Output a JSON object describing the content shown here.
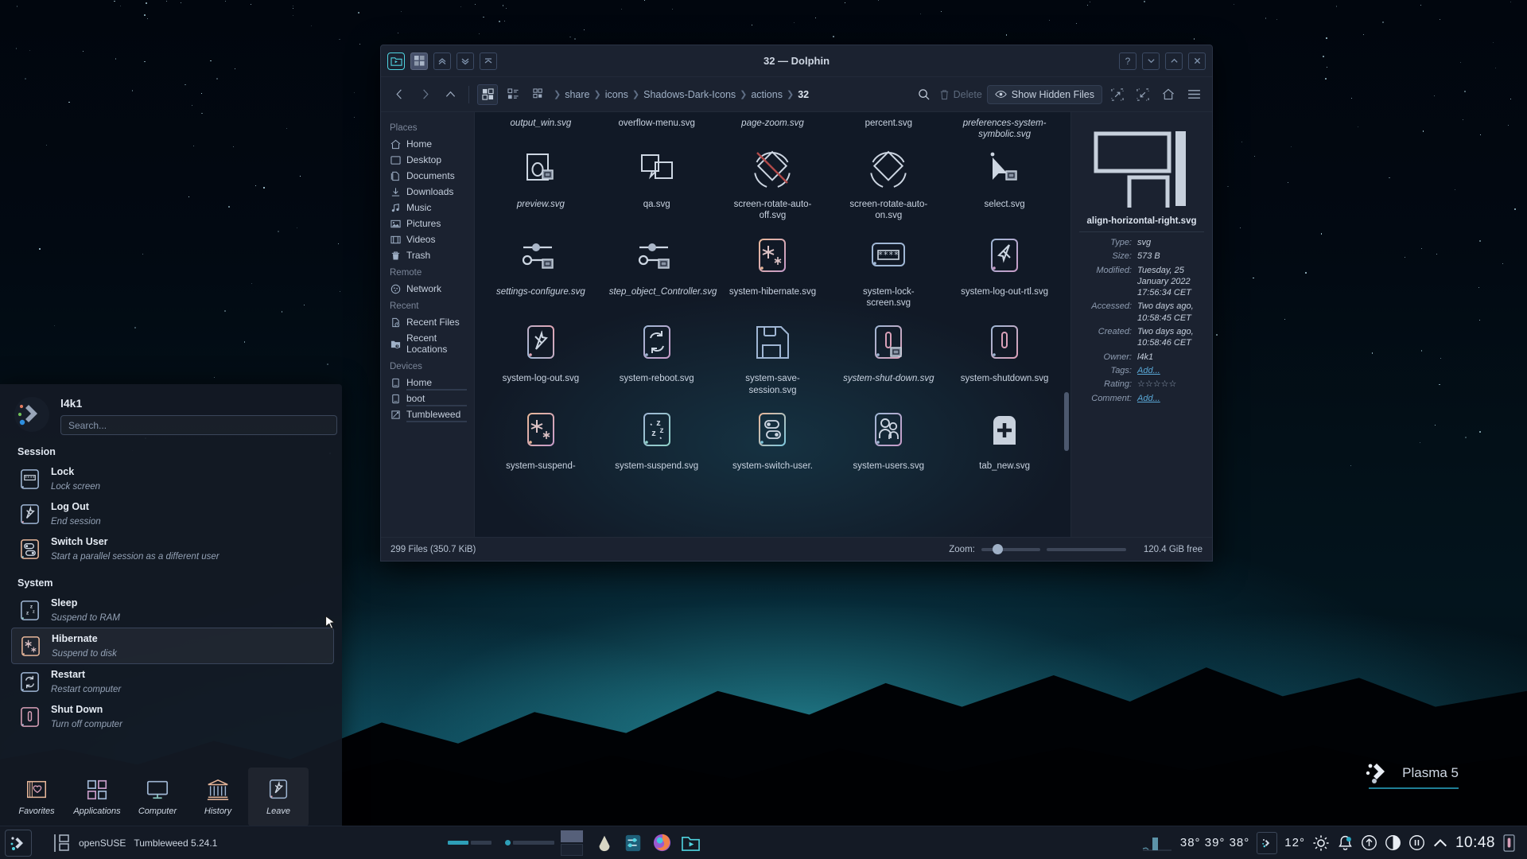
{
  "desktop": {
    "watermark": "Plasma 5"
  },
  "dolphin": {
    "window_title": "32 — Dolphin",
    "titlebar_icons": [
      "folder-icon",
      "tile-grid-icon",
      "chevron-up-double-icon",
      "chevron-down-double-icon",
      "collapse-up-icon"
    ],
    "window_buttons": [
      {
        "name": "help-button",
        "glyph": "?"
      },
      {
        "name": "minimize-button",
        "glyph": "⌄"
      },
      {
        "name": "maximize-button",
        "glyph": "⌃"
      },
      {
        "name": "close-button",
        "glyph": "✕"
      }
    ],
    "toolbar": {
      "back_icon": "back-arrow-icon",
      "forward_icon": "forward-arrow-icon",
      "up_icon": "up-arrow-icon",
      "view_icons": [
        "icons-view-icon",
        "compact-view-icon",
        "details-view-icon"
      ],
      "search_icon": "search-icon",
      "delete_label": "Delete",
      "show_hidden_label": "Show Hidden Files",
      "split_icon": "split-view-icon",
      "collapse_icon": "collapse-view-icon",
      "home_icon": "home-icon",
      "menu_icon": "hamburger-menu-icon"
    },
    "breadcrumb": [
      "share",
      "icons",
      "Shadows-Dark-Icons",
      "actions",
      "32"
    ],
    "breadcrumb_current": "32",
    "places": {
      "sections": [
        {
          "title": "Places",
          "items": [
            {
              "label": "Home",
              "icon": "home-icon"
            },
            {
              "label": "Desktop",
              "icon": "desktop-icon"
            },
            {
              "label": "Documents",
              "icon": "documents-icon"
            },
            {
              "label": "Downloads",
              "icon": "download-icon"
            },
            {
              "label": "Music",
              "icon": "music-icon"
            },
            {
              "label": "Pictures",
              "icon": "pictures-icon"
            },
            {
              "label": "Videos",
              "icon": "video-icon"
            },
            {
              "label": "Trash",
              "icon": "trash-icon"
            }
          ]
        },
        {
          "title": "Remote",
          "items": [
            {
              "label": "Network",
              "icon": "network-icon"
            }
          ]
        },
        {
          "title": "Recent",
          "items": [
            {
              "label": "Recent Files",
              "icon": "recent-file-icon"
            },
            {
              "label": "Recent Locations",
              "icon": "recent-folder-icon"
            }
          ]
        },
        {
          "title": "Devices",
          "items": [
            {
              "label": "Home",
              "icon": "drive-icon"
            },
            {
              "label": "boot",
              "icon": "drive-icon"
            },
            {
              "label": "Tumbleweed",
              "icon": "drive-icon"
            }
          ]
        }
      ]
    },
    "files": {
      "top_labels": [
        "output_win.svg",
        "overflow-menu.svg",
        "page-zoom.svg",
        "percent.svg",
        "preferences-system-symbolic.svg"
      ],
      "rows": [
        [
          {
            "name": "preview.svg",
            "icon": "preview-icon",
            "italic": true
          },
          {
            "name": "qa.svg",
            "icon": "qa-windows-icon",
            "italic": false
          },
          {
            "name": "screen-rotate-auto-off.svg",
            "icon": "screen-rotate-auto-off-icon",
            "italic": false
          },
          {
            "name": "screen-rotate-auto-on.svg",
            "icon": "screen-rotate-auto-on-icon",
            "italic": false
          },
          {
            "name": "select.svg",
            "icon": "select-cursor-icon",
            "italic": false
          }
        ],
        [
          {
            "name": "settings-configure.svg",
            "icon": "settings-configure-icon",
            "italic": true
          },
          {
            "name": "step_object_Controller.svg",
            "icon": "step-object-controller-icon",
            "italic": true
          },
          {
            "name": "system-hibernate.svg",
            "icon": "system-hibernate-icon",
            "italic": false
          },
          {
            "name": "system-lock-screen.svg",
            "icon": "system-lock-screen-icon",
            "italic": false
          },
          {
            "name": "system-log-out-rtl.svg",
            "icon": "system-log-out-rtl-icon",
            "italic": false
          }
        ],
        [
          {
            "name": "system-log-out.svg",
            "icon": "system-log-out-icon",
            "italic": false
          },
          {
            "name": "system-reboot.svg",
            "icon": "system-reboot-icon",
            "italic": false
          },
          {
            "name": "system-save-session.svg",
            "icon": "system-save-session-icon",
            "italic": false
          },
          {
            "name": "system-shut-down.svg",
            "icon": "system-shut-down-icon",
            "italic": true
          },
          {
            "name": "system-shutdown.svg",
            "icon": "system-shutdown-icon",
            "italic": false
          }
        ],
        [
          {
            "name": "system-suspend-",
            "icon": "system-suspend-hibernate-icon",
            "italic": false
          },
          {
            "name": "system-suspend.svg",
            "icon": "system-suspend-icon",
            "italic": false
          },
          {
            "name": "system-switch-user.",
            "icon": "system-switch-user-icon",
            "italic": false
          },
          {
            "name": "system-users.svg",
            "icon": "system-users-icon",
            "italic": false
          },
          {
            "name": "tab_new.svg",
            "icon": "tab-new-icon",
            "italic": false
          }
        ]
      ]
    },
    "info_panel": {
      "preview_icon": "align-horizontal-right-preview",
      "title": "align-horizontal-right.svg",
      "fields": [
        {
          "key": "Type:",
          "value": "svg"
        },
        {
          "key": "Size:",
          "value": "573 B"
        },
        {
          "key": "Modified:",
          "value": "Tuesday, 25 January 2022 17:56:34 CET"
        },
        {
          "key": "Accessed:",
          "value": "Two days ago, 10:58:45 CET"
        },
        {
          "key": "Created:",
          "value": "Two days ago, 10:58:46 CET"
        },
        {
          "key": "Owner:",
          "value": "l4k1"
        }
      ],
      "tags_key": "Tags:",
      "tags_value": "Add...",
      "rating_key": "Rating:",
      "rating_stars": "☆☆☆☆☆",
      "comment_key": "Comment:",
      "comment_value": "Add..."
    },
    "statusbar": {
      "files_text": "299 Files (350.7 KiB)",
      "zoom_label": "Zoom:",
      "free_text": "120.4 GiB free"
    }
  },
  "kickoff": {
    "user": "l4k1",
    "search_placeholder": "Search...",
    "sections": [
      {
        "title": "Session",
        "items": [
          {
            "title": "Lock",
            "subtitle": "Lock screen",
            "icon": "lock-screen-icon",
            "highlighted": false
          },
          {
            "title": "Log Out",
            "subtitle": "End session",
            "icon": "log-out-icon",
            "highlighted": false
          },
          {
            "title": "Switch User",
            "subtitle": "Start a parallel session as a different user",
            "icon": "switch-user-icon",
            "highlighted": false
          }
        ]
      },
      {
        "title": "System",
        "items": [
          {
            "title": "Sleep",
            "subtitle": "Suspend to RAM",
            "icon": "sleep-icon",
            "highlighted": false
          },
          {
            "title": "Hibernate",
            "subtitle": "Suspend to disk",
            "icon": "hibernate-icon",
            "highlighted": true
          },
          {
            "title": "Restart",
            "subtitle": "Restart computer",
            "icon": "restart-icon",
            "highlighted": false
          },
          {
            "title": "Shut Down",
            "subtitle": "Turn off computer",
            "icon": "shutdown-icon",
            "highlighted": false
          }
        ]
      }
    ],
    "tabs": [
      {
        "label": "Favorites",
        "icon": "favorites-heart-icon",
        "active": false
      },
      {
        "label": "Applications",
        "icon": "applications-grid-icon",
        "active": false
      },
      {
        "label": "Computer",
        "icon": "computer-monitor-icon",
        "active": false
      },
      {
        "label": "History",
        "icon": "history-bank-icon",
        "active": false
      },
      {
        "label": "Leave",
        "icon": "leave-arrow-icon",
        "active": true
      }
    ]
  },
  "panel": {
    "launcher_icon": "plasma-launcher-icon",
    "task_icon": "task-window-icon",
    "task_label_1": "openSUSE",
    "task_label_2": "Tumbleweed 5.24.1",
    "pager_icon": "pager-icon",
    "tray_icons": [
      {
        "name": "krita-icon"
      },
      {
        "name": "settings-sliders-icon"
      },
      {
        "name": "firefox-icon"
      },
      {
        "name": "dolphin-icon"
      }
    ],
    "sys_temps": "38° 39° 38°",
    "weather_temp": "12°",
    "weather_icon": "sun-icon",
    "status_icons": [
      {
        "name": "notifications-bell-icon"
      },
      {
        "name": "updates-icon"
      },
      {
        "name": "night-color-icon"
      },
      {
        "name": "media-pause-icon"
      },
      {
        "name": "show-hidden-tray-icon"
      }
    ],
    "clock": "10:48",
    "battery_icon": "battery-icon"
  }
}
